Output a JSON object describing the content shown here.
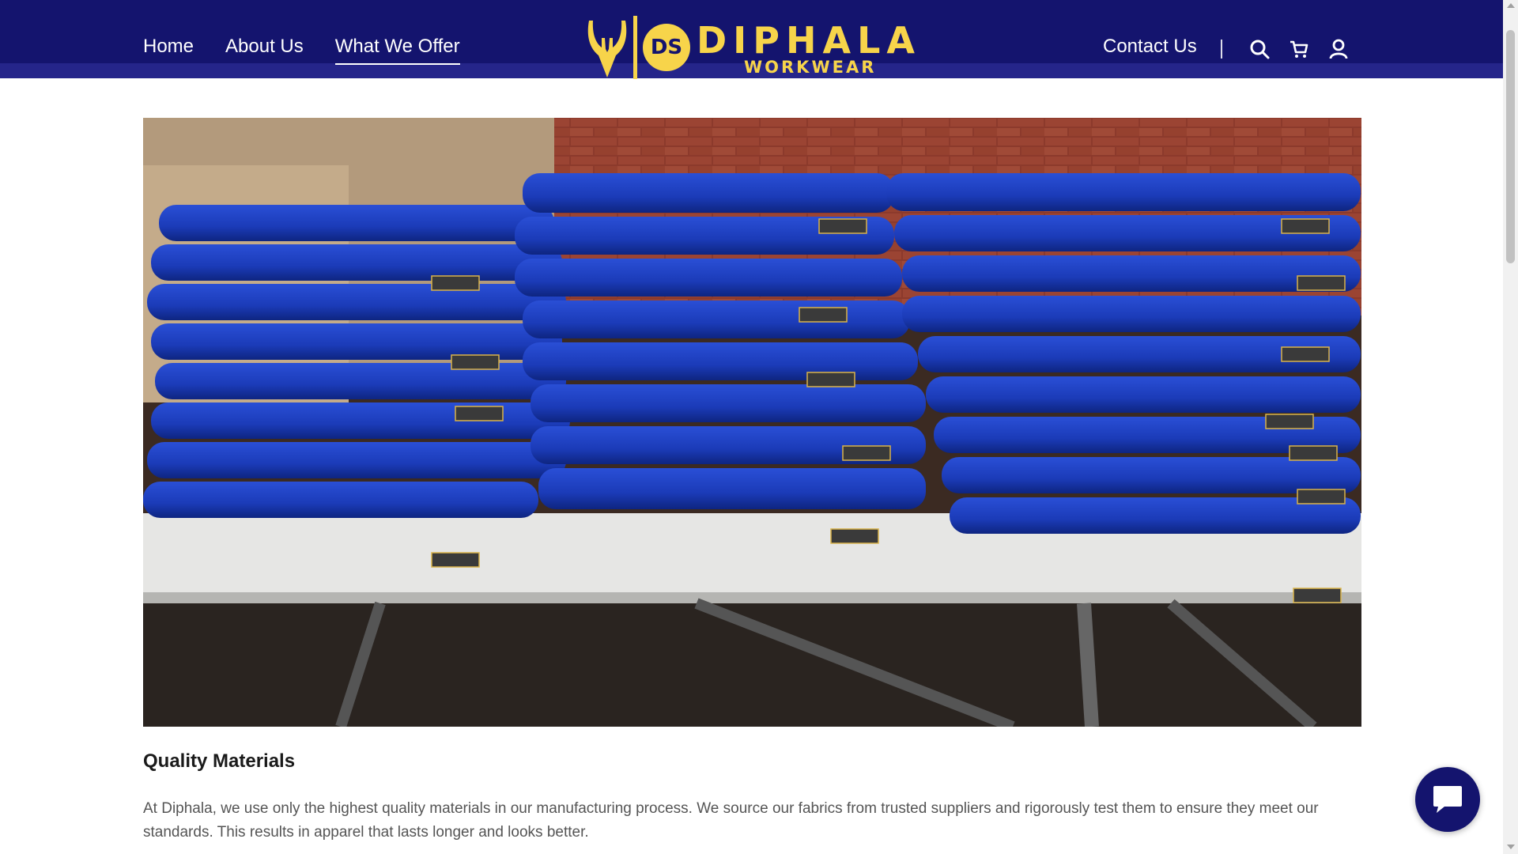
{
  "header": {
    "nav_left": [
      "Home",
      "About Us",
      "What We Offer"
    ],
    "active_item": "What We Offer",
    "contact_label": "Contact Us",
    "icons": [
      "search-icon",
      "cart-icon",
      "user-icon"
    ],
    "background_color": "#14146e",
    "accent_color": "#f7d44a"
  },
  "logo": {
    "badge": "DS",
    "name": "DIPHALA",
    "subtitle": "WORKWEAR"
  },
  "hero": {
    "image_label": "photo of stacked blue workwear garments on a table"
  },
  "content": {
    "title": "Quality Materials",
    "body": "At Diphala, we use only the highest quality materials in our manufacturing process. We source our fabrics from trusted suppliers and rigorously test them to ensure they meet our standards. This results in apparel that lasts longer and looks better."
  },
  "chat": {
    "icon": "chat-bubble-icon"
  }
}
